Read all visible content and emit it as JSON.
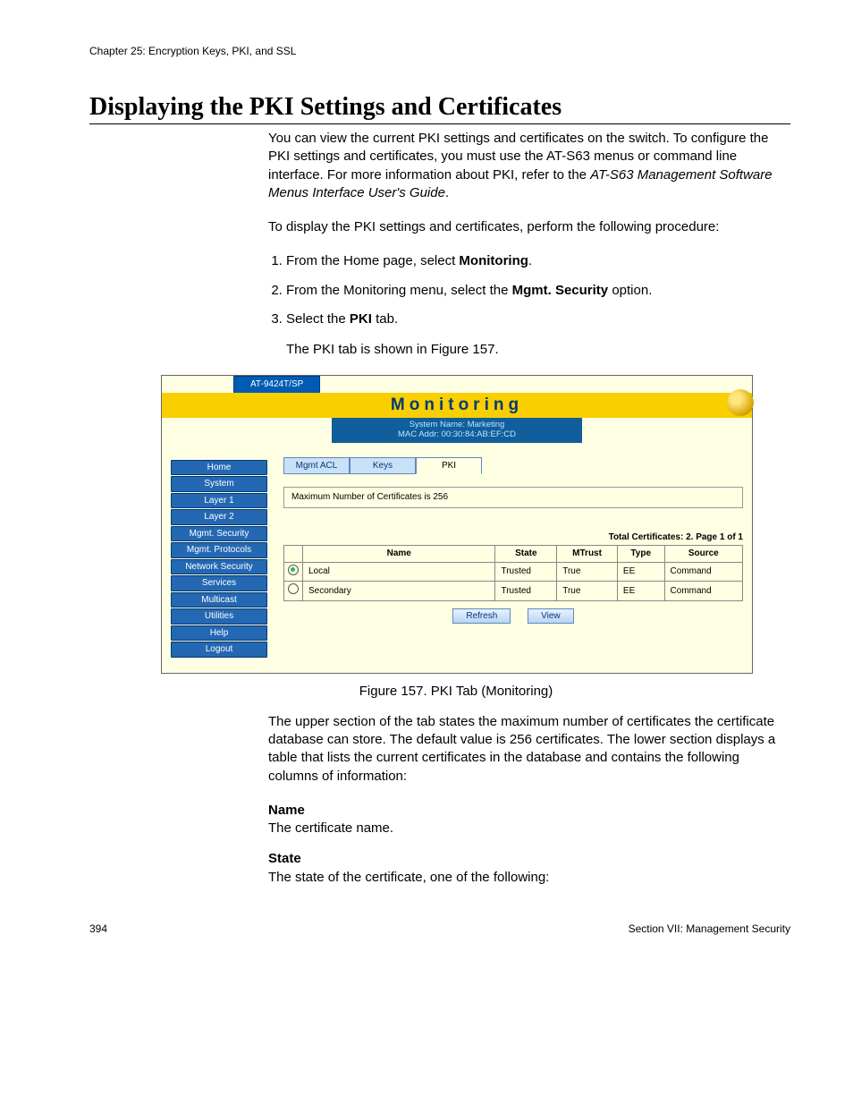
{
  "chapter": "Chapter 25: Encryption Keys, PKI, and SSL",
  "title": "Displaying the PKI Settings and Certificates",
  "intro": {
    "p1a": "You can view the current PKI settings and certificates on the switch. To configure the PKI settings and certificates, you must use the AT-S63 menus or command line interface. For more information about PKI, refer to the ",
    "p1b": "AT-S63 Management Software Menus Interface User's Guide",
    "p1c": ".",
    "p2": "To display the PKI settings and certificates, perform the following procedure:"
  },
  "steps": {
    "s1a": "From the Home page, select ",
    "s1b": "Monitoring",
    "s1c": ".",
    "s2a": "From the Monitoring menu, select the ",
    "s2b": "Mgmt. Security",
    "s2c": " option.",
    "s3a": "Select the ",
    "s3b": "PKI",
    "s3c": " tab.",
    "after": "The PKI tab is shown in Figure 157."
  },
  "ui": {
    "model": "AT-9424T/SP",
    "page_title": "Monitoring",
    "sys_name": "System Name: Marketing",
    "mac": "MAC Addr: 00:30:84:AB:EF:CD",
    "nav": [
      "Home",
      "System",
      "Layer 1",
      "Layer 2",
      "Mgmt. Security",
      "Mgmt. Protocols",
      "Network Security",
      "Services",
      "Multicast",
      "Utilities",
      "Help",
      "Logout"
    ],
    "tabs": [
      "Mgmt ACL",
      "Keys",
      "PKI"
    ],
    "max_cert": "Maximum Number of Certificates is 256",
    "total": "Total Certificates: 2. Page 1 of 1",
    "cols": {
      "name": "Name",
      "state": "State",
      "mtrust": "MTrust",
      "type": "Type",
      "source": "Source"
    },
    "rows": [
      {
        "sel": true,
        "name": "Local",
        "state": "Trusted",
        "mtrust": "True",
        "type": "EE",
        "source": "Command"
      },
      {
        "sel": false,
        "name": "Secondary",
        "state": "Trusted",
        "mtrust": "True",
        "type": "EE",
        "source": "Command"
      }
    ],
    "btn_refresh": "Refresh",
    "btn_view": "View"
  },
  "figure_caption": "Figure 157. PKI Tab (Monitoring)",
  "after_figure": "The upper section of the tab states the maximum number of certificates the certificate database can store. The default value is 256 certificates. The lower section displays a table that lists the current certificates in the database and contains the following columns of information:",
  "defs": {
    "name_t": "Name",
    "name_d": "The certificate name.",
    "state_t": "State",
    "state_d": "The state of the certificate, one of the following:"
  },
  "footer": {
    "page": "394",
    "section": "Section VII: Management Security"
  }
}
